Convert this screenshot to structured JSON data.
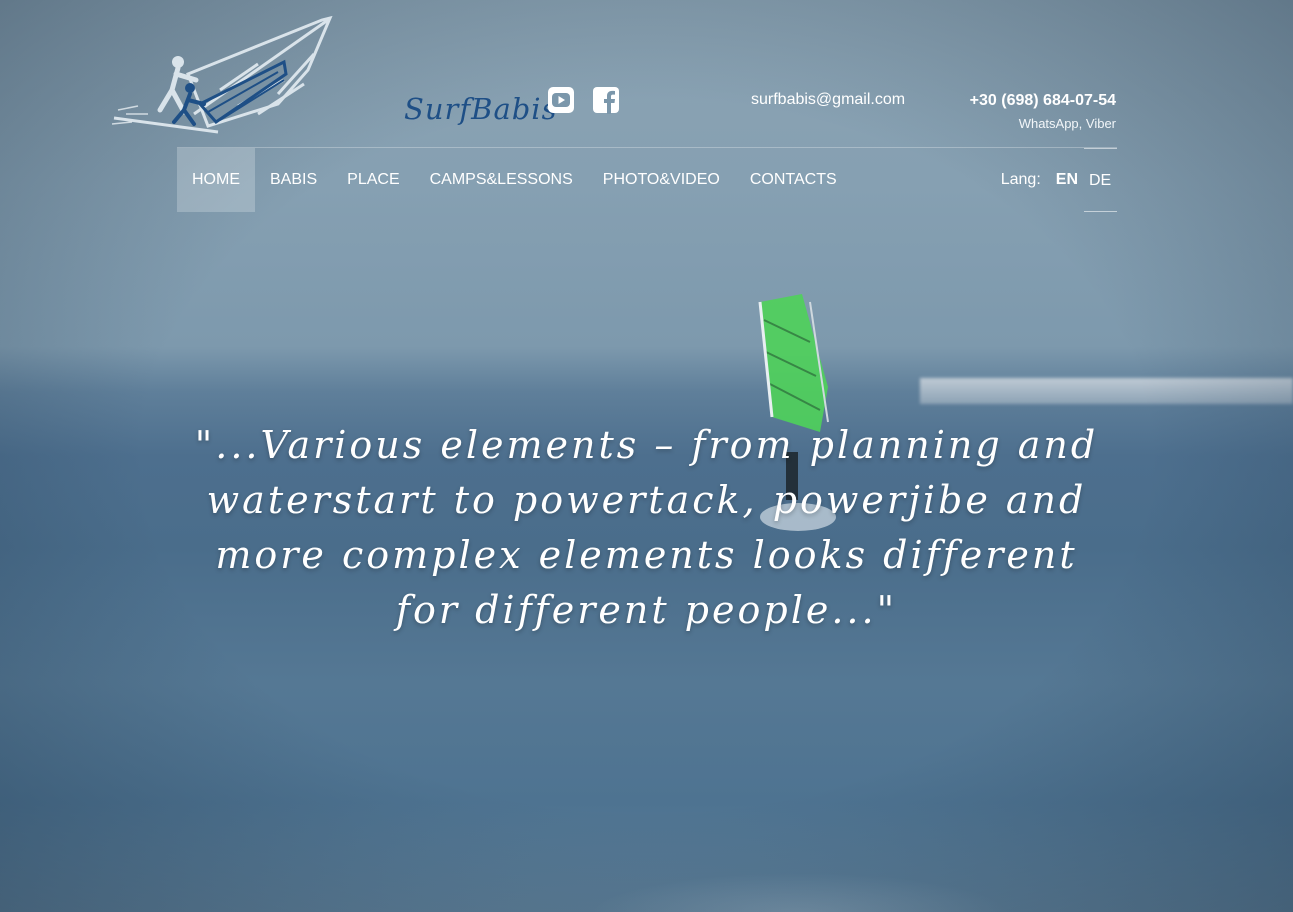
{
  "brand": {
    "name": "SurfBabis"
  },
  "social": [
    {
      "name": "youtube"
    },
    {
      "name": "facebook"
    }
  ],
  "contact": {
    "email": "surfbabis@gmail.com",
    "phone": "+30 (698) 684-07-54",
    "phone_note": "WhatsApp, Viber"
  },
  "nav": {
    "items": [
      {
        "label": "HOME",
        "active": true
      },
      {
        "label": "BABIS"
      },
      {
        "label": "PLACE"
      },
      {
        "label": "CAMPS&LESSONS"
      },
      {
        "label": "PHOTO&VIDEO"
      },
      {
        "label": "CONTACTS"
      }
    ]
  },
  "lang": {
    "label": "Lang:",
    "options": [
      {
        "code": "EN",
        "current": true
      },
      {
        "code": "DE"
      }
    ]
  },
  "hero": {
    "quote": "\"...Various elements – from planning and waterstart to powertack, powerjibe and more complex elements looks different for different people...\""
  },
  "colors": {
    "logo_blue": "#1e4f86",
    "sail_green": "#4fd15a",
    "text": "#ffffff"
  }
}
